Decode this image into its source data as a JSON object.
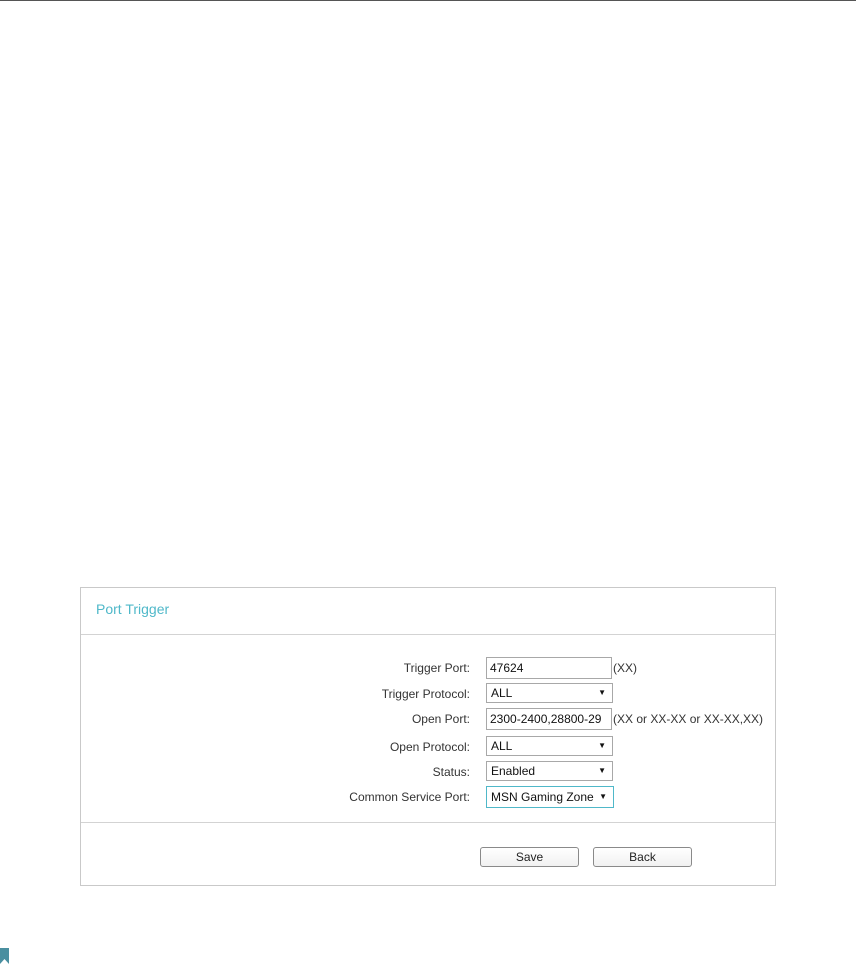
{
  "panel": {
    "title": "Port Trigger"
  },
  "form": {
    "trigger_port": {
      "label": "Trigger Port:",
      "value": "47624",
      "hint": "(XX)"
    },
    "trigger_protocol": {
      "label": "Trigger Protocol:",
      "value": "ALL"
    },
    "open_port": {
      "label": "Open Port:",
      "value": "2300-2400,28800-29",
      "hint": "(XX or XX-XX or XX-XX,XX)"
    },
    "open_protocol": {
      "label": "Open Protocol:",
      "value": "ALL"
    },
    "status": {
      "label": "Status:",
      "value": "Enabled"
    },
    "common_service_port": {
      "label": "Common Service Port:",
      "value": "MSN Gaming Zone"
    }
  },
  "buttons": {
    "save_label": "Save",
    "back_label": "Back"
  },
  "caret_glyph": "▼",
  "colors": {
    "title": "#4fb8c9",
    "active_border": "#4fb8c9",
    "bookmark": "#4a8fa0"
  },
  "icons": {
    "caret": "dropdown-caret-icon",
    "bookmark": "bookmark-icon"
  }
}
